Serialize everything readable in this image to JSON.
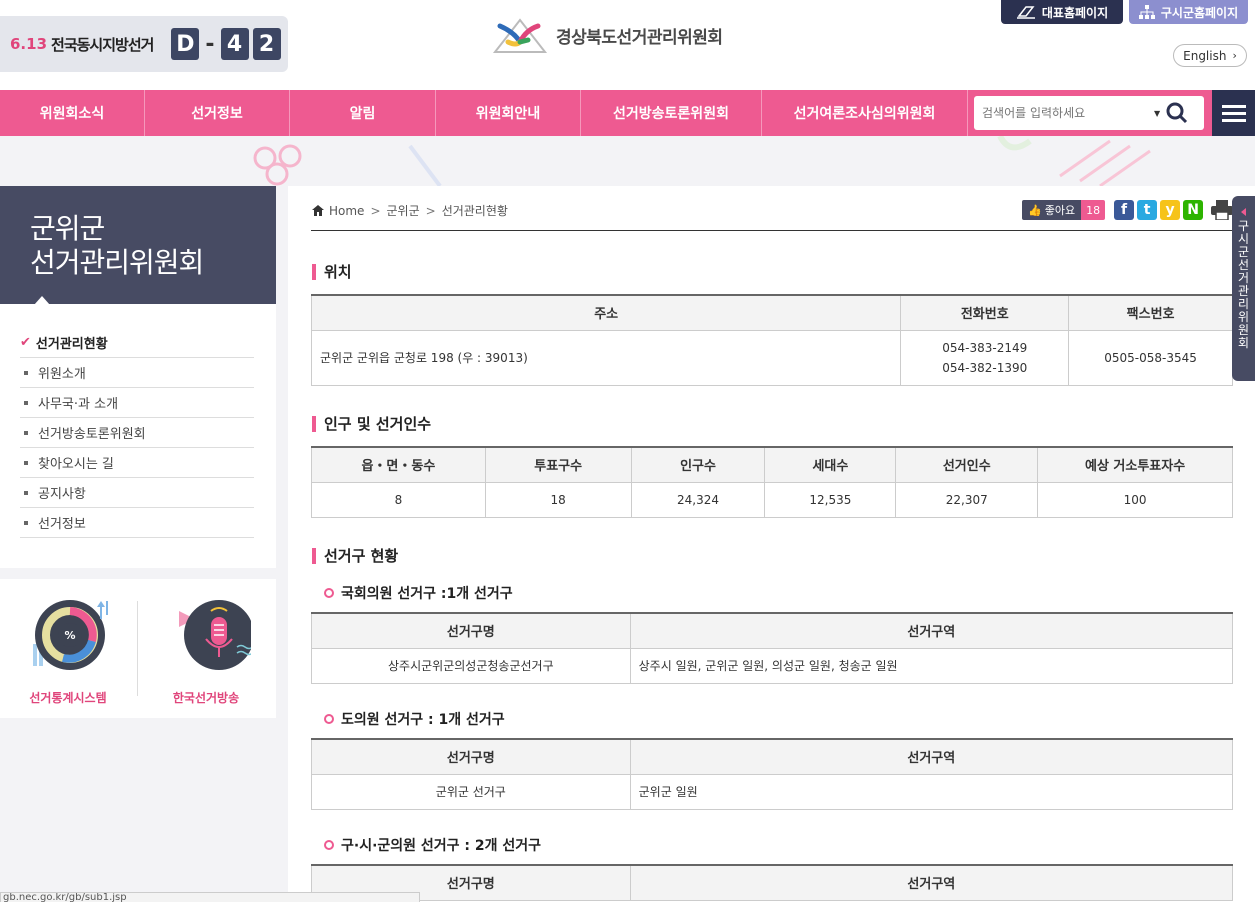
{
  "dday": {
    "date": "6.13",
    "election": "전국동시지방선거",
    "d_letter": "D",
    "dash": "-",
    "digits": [
      "4",
      "2"
    ]
  },
  "logo": {
    "text": "경상북도선거관리위원회"
  },
  "top_links": {
    "representative": "대표홈페이지",
    "local": "구시군홈페이지"
  },
  "lang_button": "English",
  "nav": {
    "items": [
      "위원회소식",
      "선거정보",
      "알림",
      "위원회안내",
      "선거방송토론위원회",
      "선거여론조사심의위원회"
    ],
    "search_placeholder": "검색어를 입력하세요"
  },
  "sidebar": {
    "title_line1": "군위군",
    "title_line2": "선거관리위원회",
    "items": [
      "선거관리현황",
      "위원소개",
      "사무국·과 소개",
      "선거방송토론위원회",
      "찾아오시는 길",
      "공지사항",
      "선거정보"
    ],
    "banners": [
      "선거통계시스템",
      "한국선거방송"
    ],
    "stat_icon_text": "%"
  },
  "breadcrumb": [
    "Home",
    "군위군",
    "선거관리현황"
  ],
  "social": {
    "like_label": "좋아요",
    "like_count": "18",
    "sns": [
      "f",
      "t",
      "y",
      "N"
    ]
  },
  "location": {
    "heading": "위치",
    "headers": [
      "주소",
      "전화번호",
      "팩스번호"
    ],
    "address": "군위군 군위읍 군청로 198 (우 : 39013)",
    "phones": [
      "054-383-2149",
      "054-382-1390"
    ],
    "fax": "0505-058-3545"
  },
  "population": {
    "heading": "인구 및 선거인수",
    "headers": [
      "읍・면・동수",
      "투표구수",
      "인구수",
      "세대수",
      "선거인수",
      "예상 거소투표자수"
    ],
    "values": [
      "8",
      "18",
      "24,324",
      "12,535",
      "22,307",
      "100"
    ]
  },
  "districts": {
    "heading": "선거구 현황",
    "national": {
      "title": "국회의원 선거구 :1개 선거구",
      "headers": [
        "선거구명",
        "선거구역"
      ],
      "name": "상주시군위군의성군청송군선거구",
      "area": "상주시 일원, 군위군 일원, 의성군 일원, 청송군 일원"
    },
    "provincial": {
      "title": "도의원 선거구 : 1개 선거구",
      "headers": [
        "선거구명",
        "선거구역"
      ],
      "name": "군위군 선거구",
      "area": "군위군 일원"
    },
    "local": {
      "title": "구·시·군의원 선거구 : 2개 선거구",
      "headers": [
        "선거구명",
        "선거구역"
      ]
    }
  },
  "float_tab": "구시군선거관리위원회",
  "status_url": "gb.nec.go.kr/gb/sub1.jsp",
  "colors": {
    "accent_pink": "#ee5a91",
    "navy": "#2b3150",
    "slate": "#474b63",
    "lavender": "#8c8fcf"
  }
}
